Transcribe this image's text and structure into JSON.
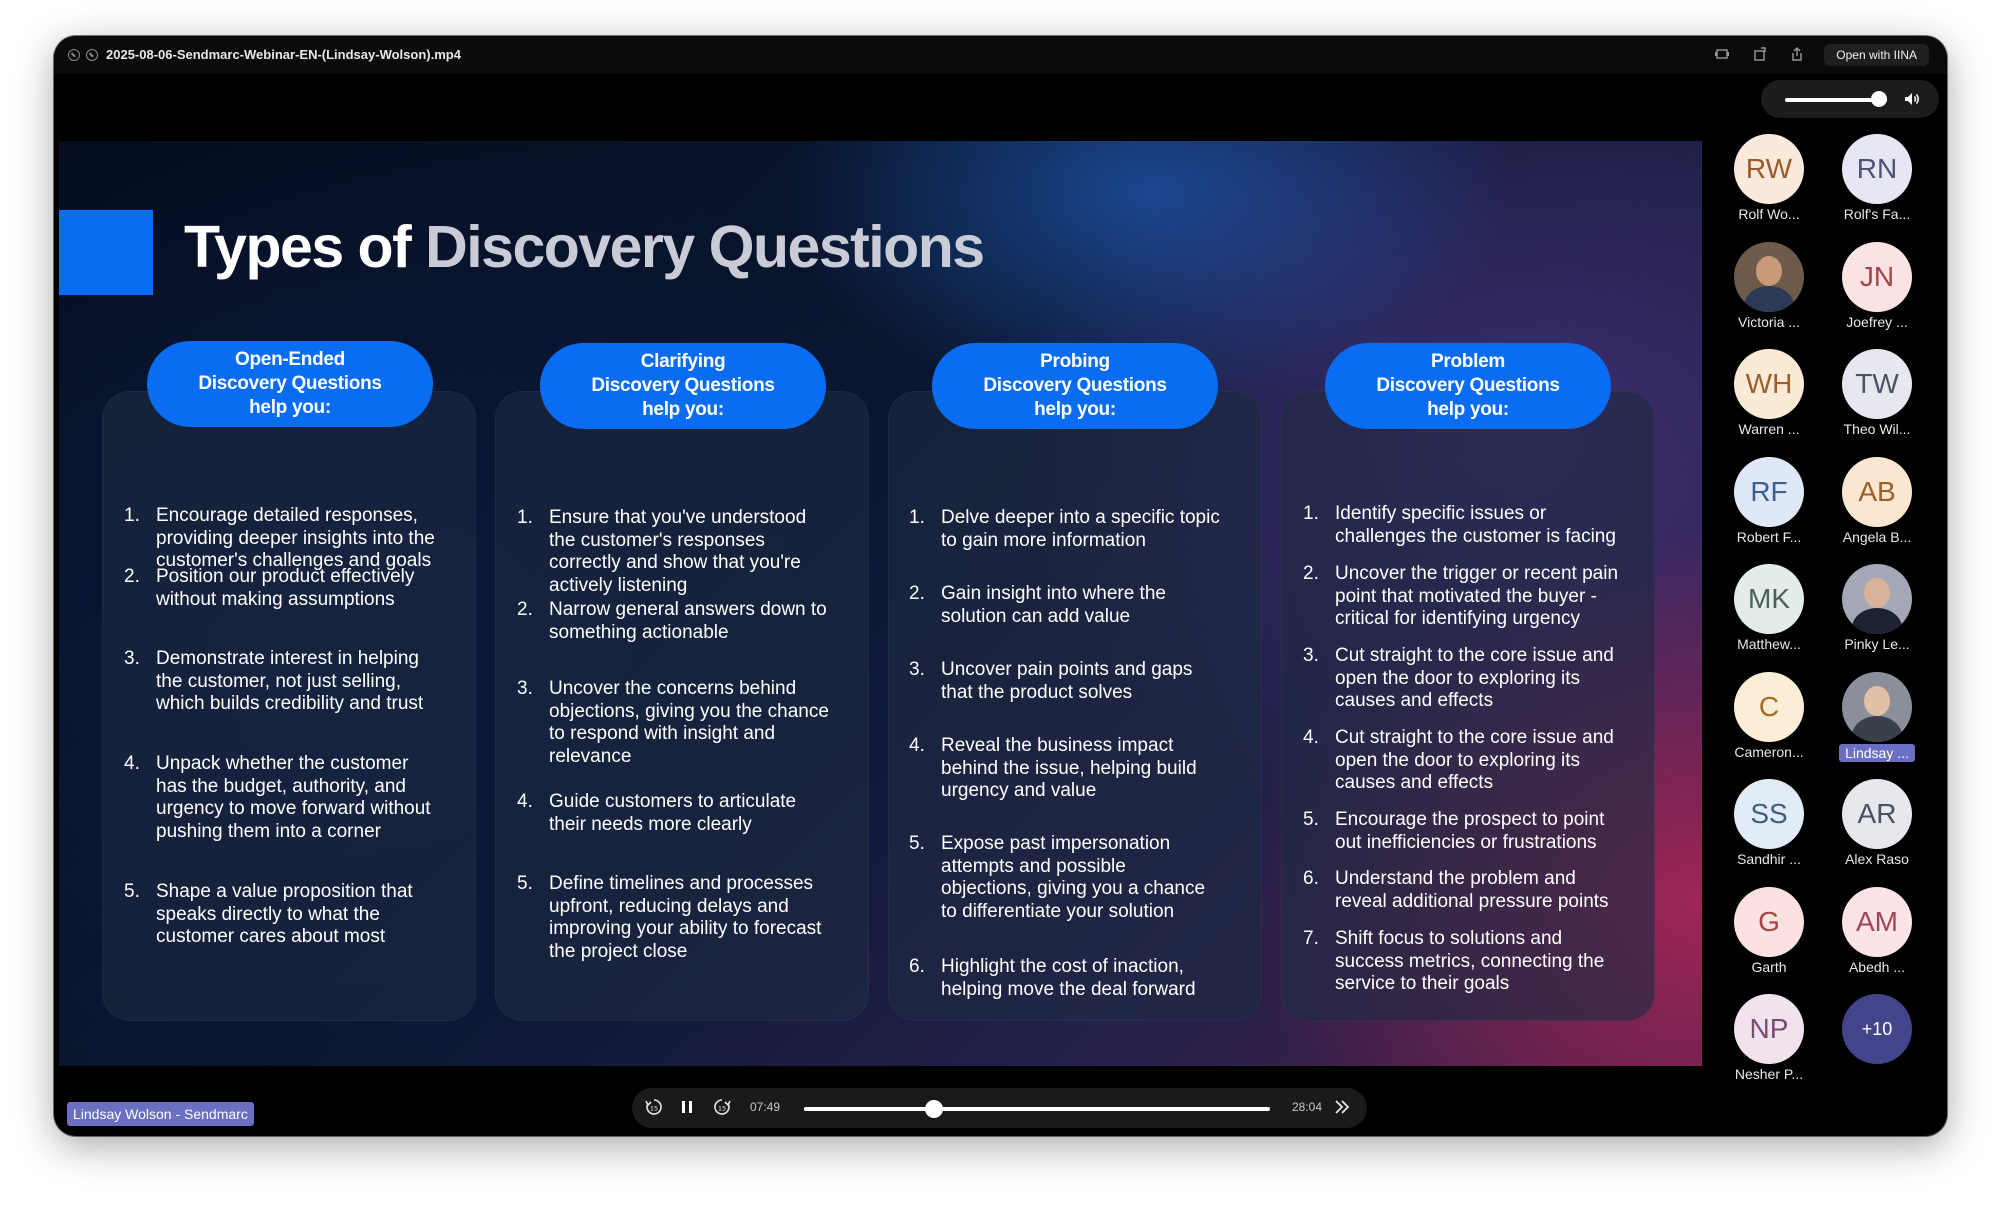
{
  "window": {
    "title": "2025-08-06-Sendmarc-Webinar-EN-(Lindsay-Wolson).mp4",
    "open_with_label": "Open with IINA"
  },
  "volume": {
    "level": 0.92
  },
  "slide": {
    "title_part1": "Types of ",
    "title_part2": "Discovery Questions",
    "columns": [
      {
        "heading": [
          "Open-Ended",
          "Discovery Questions",
          "help you:"
        ],
        "items": [
          {
            "n": "1.",
            "lines": [
              "Encourage detailed responses,",
              "providing deeper insights into the",
              "customer's challenges and goals"
            ]
          },
          {
            "n": "2.",
            "lines": [
              "Position our product effectively",
              "without making assumptions"
            ]
          },
          {
            "n": "3.",
            "lines": [
              "Demonstrate interest in helping",
              "the customer, not just selling,",
              "which builds credibility and trust"
            ]
          },
          {
            "n": "4.",
            "lines": [
              "Unpack whether the customer",
              "has the budget, authority, and",
              "urgency to move forward without",
              "pushing them into a corner"
            ]
          },
          {
            "n": "5.",
            "lines": [
              "Shape a value proposition that",
              "speaks directly to what the",
              "customer cares about most"
            ]
          }
        ]
      },
      {
        "heading": [
          "Clarifying",
          "Discovery Questions",
          "help you:"
        ],
        "items": [
          {
            "n": "1.",
            "lines": [
              "Ensure that you've understood",
              "the customer's responses",
              "correctly and show that you're",
              "actively listening"
            ]
          },
          {
            "n": "2.",
            "lines": [
              "Narrow general answers down to",
              "something actionable"
            ]
          },
          {
            "n": "3.",
            "lines": [
              "Uncover the concerns behind",
              "objections, giving you the chance",
              "to respond with insight and",
              "relevance"
            ]
          },
          {
            "n": "4.",
            "lines": [
              "Guide customers to articulate",
              "their needs more clearly"
            ]
          },
          {
            "n": "5.",
            "lines": [
              "Define timelines and processes",
              "upfront, reducing delays and",
              "improving your ability to forecast",
              "the project close"
            ]
          }
        ]
      },
      {
        "heading": [
          "Probing",
          "Discovery Questions",
          "help you:"
        ],
        "items": [
          {
            "n": "1.",
            "lines": [
              "Delve deeper into a specific topic",
              "to gain more information"
            ]
          },
          {
            "n": "2.",
            "lines": [
              "Gain insight into where the",
              "solution can add value"
            ]
          },
          {
            "n": "3.",
            "lines": [
              "Uncover pain points and gaps",
              "that the product solves"
            ]
          },
          {
            "n": "4.",
            "lines": [
              "Reveal the business impact",
              "behind the issue, helping build",
              "urgency and value"
            ]
          },
          {
            "n": "5.",
            "lines": [
              "Expose past impersonation",
              "attempts and possible",
              "objections, giving you a chance",
              "to differentiate your solution"
            ]
          },
          {
            "n": "6.",
            "lines": [
              "Highlight the cost of inaction,",
              "helping move the deal forward"
            ]
          }
        ]
      },
      {
        "heading": [
          "Problem",
          "Discovery Questions",
          "help you:"
        ],
        "items": [
          {
            "n": "1.",
            "lines": [
              "Identify specific issues or",
              "challenges the customer is facing"
            ]
          },
          {
            "n": "2.",
            "lines": [
              "Uncover the trigger or recent pain",
              "point that motivated the buyer -",
              "critical for identifying urgency"
            ]
          },
          {
            "n": "3.",
            "lines": [
              "Cut straight to the core issue and",
              "open the door to exploring its",
              "causes and effects"
            ]
          },
          {
            "n": "4.",
            "lines": [
              "Cut straight to the core issue and",
              "open the door to exploring its",
              "causes and effects"
            ]
          },
          {
            "n": "5.",
            "lines": [
              "Encourage the prospect to point",
              "out inefficiencies or frustrations"
            ]
          },
          {
            "n": "6.",
            "lines": [
              "Understand the problem and",
              "reveal additional pressure points"
            ]
          },
          {
            "n": "7.",
            "lines": [
              "Shift focus to solutions and",
              "success metrics, connecting the",
              "service to their goals"
            ]
          }
        ]
      }
    ]
  },
  "participants": [
    {
      "initials": "RW",
      "name": "Rolf Wo...",
      "bg": "#fbe9dc",
      "fg": "#9a5a2e"
    },
    {
      "initials": "RN",
      "name": "Rolf's Fa...",
      "bg": "#e6e7f3",
      "fg": "#4d5276"
    },
    {
      "initials": "",
      "name": "Victoria ...",
      "bg": "#6d5a4a",
      "fg": "#ffffff",
      "photo": true,
      "face": "#c99a7a",
      "body": "#2c3a55"
    },
    {
      "initials": "JN",
      "name": "Joefrey ...",
      "bg": "#fbe3e3",
      "fg": "#a0474a"
    },
    {
      "initials": "WH",
      "name": "Warren ...",
      "bg": "#fbead6",
      "fg": "#9a5f2a"
    },
    {
      "initials": "TW",
      "name": "Theo Wil...",
      "bg": "#e7e8ef",
      "fg": "#4c5166"
    },
    {
      "initials": "RF",
      "name": "Robert F...",
      "bg": "#dfe8f6",
      "fg": "#3c5d92"
    },
    {
      "initials": "AB",
      "name": "Angela B...",
      "bg": "#fbe6d2",
      "fg": "#9a5f2a"
    },
    {
      "initials": "MK",
      "name": "Matthew...",
      "bg": "#e4ece9",
      "fg": "#4b6058"
    },
    {
      "initials": "",
      "name": "Pinky Le...",
      "bg": "#a4a8b6",
      "fg": "#ffffff",
      "photo": true,
      "face": "#d7b39a",
      "body": "#1d2230"
    },
    {
      "initials": "C",
      "name": "Cameron...",
      "bg": "#fbeed7",
      "fg": "#a36a22"
    },
    {
      "initials": "",
      "name": "Lindsay ...",
      "bg": "#8b8f9a",
      "fg": "#ffffff",
      "photo": true,
      "face": "#e1c0a5",
      "body": "#3a3f4c",
      "highlight": true
    },
    {
      "initials": "SS",
      "name": "Sandhir ...",
      "bg": "#e2ecf6",
      "fg": "#3e5f80"
    },
    {
      "initials": "AR",
      "name": "Alex Raso",
      "bg": "#e6e8ee",
      "fg": "#4a5064"
    },
    {
      "initials": "G",
      "name": "Garth",
      "bg": "#fbe1df",
      "fg": "#a0453f"
    },
    {
      "initials": "AM",
      "name": "Abedh ...",
      "bg": "#fbe3e6",
      "fg": "#a04556"
    },
    {
      "initials": "NP",
      "name": "Nesher P...",
      "bg": "#f0e3ee",
      "fg": "#7a4c70"
    },
    {
      "initials": "+10",
      "name": "",
      "bg": "#42458a",
      "fg": "#ffffff",
      "more": true
    }
  ],
  "speaker_tag": "Lindsay Wolson - Sendmarc",
  "player": {
    "current_time": "07:49",
    "total_time": "28:04",
    "progress": 0.279,
    "rewind_icon": "rewind-15-icon",
    "pause_icon": "pause-icon",
    "forward_icon": "forward-15-icon",
    "next_icon": "skip-forward-icon"
  }
}
